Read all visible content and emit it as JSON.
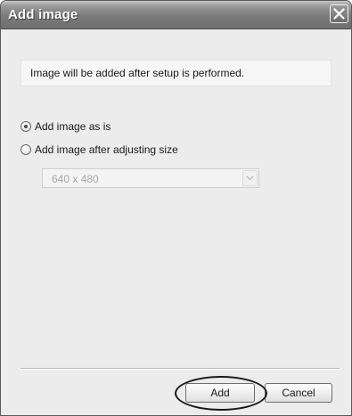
{
  "window": {
    "title": "Add image",
    "close_icon": "close-icon"
  },
  "info": {
    "message": "Image will be added after setup is performed."
  },
  "options": {
    "as_is_label": "Add image as is",
    "adjust_label": "Add image after adjusting size",
    "selected": "as_is"
  },
  "size_select": {
    "value": "640 x 480",
    "enabled": false,
    "icon": "chevron-down-icon"
  },
  "buttons": {
    "add_label": "Add",
    "cancel_label": "Cancel"
  }
}
